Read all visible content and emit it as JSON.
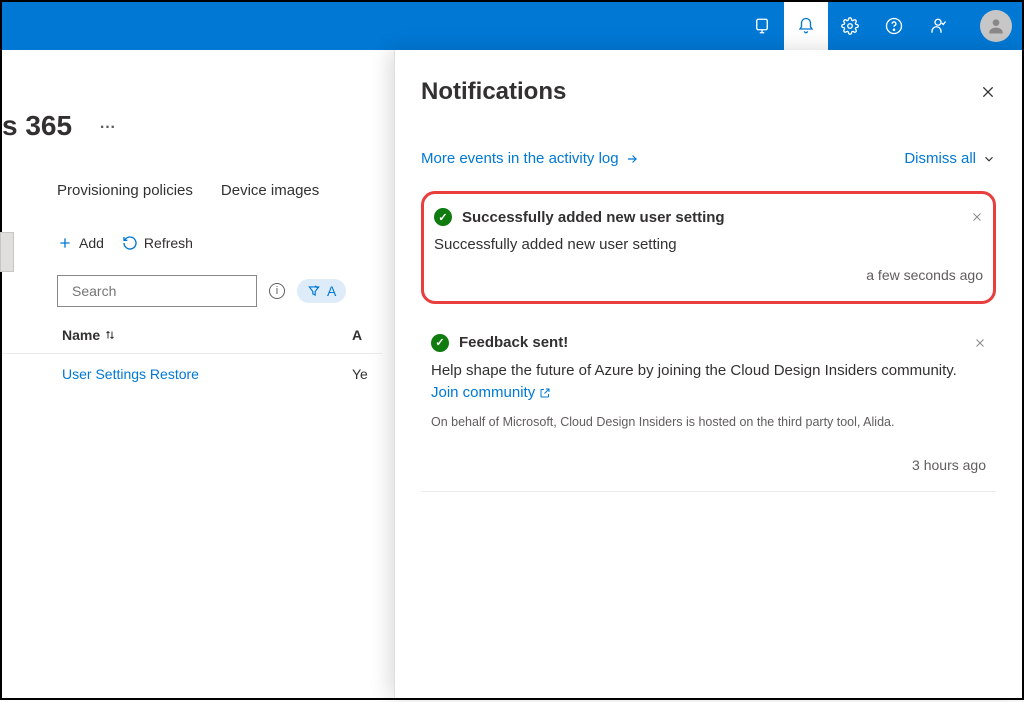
{
  "page": {
    "title_fragment": "s 365"
  },
  "tabs": {
    "provisioning": "Provisioning policies",
    "device_images": "Device images"
  },
  "toolbar": {
    "add": "Add",
    "refresh": "Refresh"
  },
  "search": {
    "placeholder": "Search"
  },
  "filter": {
    "label": "A"
  },
  "table": {
    "head_name": "Name",
    "head_a": "A",
    "row1_name": "User Settings Restore",
    "row1_a": "Ye"
  },
  "panel": {
    "title": "Notifications",
    "more_events": "More events in the activity log",
    "dismiss_all": "Dismiss all"
  },
  "notif1": {
    "title": "Successfully added new user setting",
    "body": "Successfully added new user setting",
    "time": "a few seconds ago"
  },
  "notif2": {
    "title": "Feedback sent!",
    "body_prefix": "Help shape the future of Azure by joining the Cloud Design Insiders community. ",
    "body_link": "Join community",
    "footnote": "On behalf of Microsoft, Cloud Design Insiders is hosted on the third party tool, Alida.",
    "time": "3 hours ago"
  }
}
